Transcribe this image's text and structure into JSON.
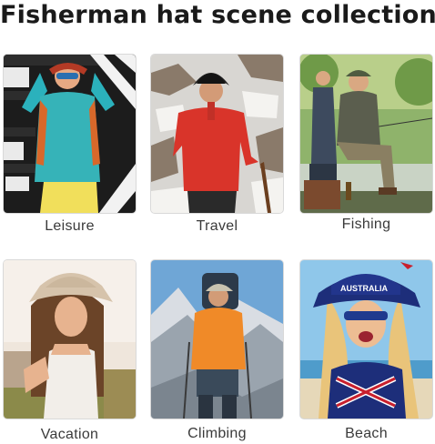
{
  "title": "Fisherman hat scene collection",
  "scenes": [
    {
      "label": "Leisure",
      "icon": "woman-in-sunglasses-photo"
    },
    {
      "label": "Travel",
      "icon": "man-on-rocks-photo"
    },
    {
      "label": "Fishing",
      "icon": "fishermen-photo"
    },
    {
      "label": "Vacation",
      "icon": "woman-in-bucket-hat-photo"
    },
    {
      "label": "Climbing",
      "icon": "mountain-climber-photo"
    },
    {
      "label": "Beach",
      "icon": "flag-hat-beach-photo"
    }
  ],
  "colors": {
    "title": "#1a1a1a",
    "caption": "#3a3a3a",
    "border": "#d9d9d9"
  }
}
